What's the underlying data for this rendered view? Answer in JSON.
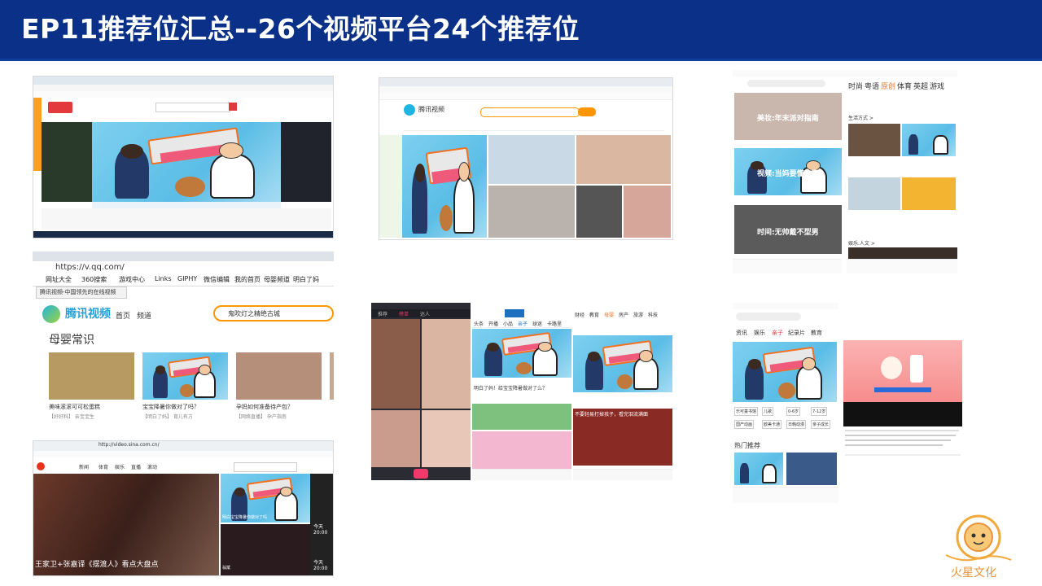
{
  "header": {
    "title": "EP11推荐位汇总--26个视频平台24个推荐位"
  },
  "shots": {
    "qinzi_pc": {
      "brand": "亲子"
    },
    "tencent_pc": {
      "search": "腾讯视频"
    },
    "phone_right_top": {
      "tabs": [
        "时尚",
        "粤语",
        "原创",
        "体育",
        "英超",
        "游戏"
      ],
      "items": [
        "美妆:年末派对指南",
        "视频:当妈要懂的事",
        "时间:无帅戴不型男",
        "生活方式 >",
        "娱乐.人文 >"
      ]
    },
    "qq_zoom": {
      "url": "https://v.qq.com/",
      "bookmarks": [
        "网址大全",
        "360搜索",
        "游戏中心",
        "Links",
        "GIPHY",
        "微信编辑",
        "我的首页",
        "母婴频道",
        "明白了妈",
        "粉粉创作"
      ],
      "tab_title": "腾讯视频-中国领先的在线视频",
      "nav_home": "首页",
      "nav_channel": "频道",
      "search_placeholder": "鬼吹灯之精绝古城",
      "section": "母婴常识",
      "cards": [
        {
          "title": "美味滚滚可可松蛋糕",
          "sub": "【好好料】 亲宝宝生"
        },
        {
          "title": "宝宝降暑你做对了吗？",
          "sub": "【明白了妈】 育儿有方"
        },
        {
          "title": "孕妈如何准备待产包？",
          "sub": "【网络直播】 孕产指南"
        }
      ]
    },
    "sina": {
      "url": "http://video.sina.com.cn/",
      "nav": [
        "新闻",
        "体育",
        "娱乐",
        "直播",
        "滚动"
      ],
      "caption_left": "王家卫+张嘉译《摆渡人》看点大盘点",
      "caption_right": "明白宝宝降暑你做对了吗",
      "caption_bottom": "翁斌",
      "time_top": "今天 20:00",
      "time_bottom": "今天 20:00"
    },
    "phones_mid": {
      "tabs_a": [
        "推荐",
        "榜单",
        "达人"
      ],
      "tabs_b": [
        "头条",
        "开播",
        "小品",
        "亲子",
        "球迷",
        "卡路里"
      ],
      "tabs_c": [
        "财经",
        "教育",
        "母婴",
        "房产",
        "旅游",
        "科技"
      ],
      "caption_a": "明白了妈！给宝宝降暑做对了么？",
      "caption_c": "不要轻易打掉孩子，看完泪流满面"
    },
    "phone_right_bottom": {
      "tabs": [
        "资讯",
        "娱乐",
        "亲子",
        "纪录片",
        "教育"
      ],
      "chips": [
        "乐可童书馆",
        "儿歌",
        "0-6岁",
        "7-12岁",
        "国产动画",
        "欧美卡通",
        "日韩动漫",
        "亲子成长"
      ],
      "section": "热门推荐"
    }
  },
  "colors": {
    "header_bg": "#0a3187",
    "accent_orange": "#f37021",
    "qq_orange": "#ff9600",
    "pink": "#ef3a6a"
  }
}
